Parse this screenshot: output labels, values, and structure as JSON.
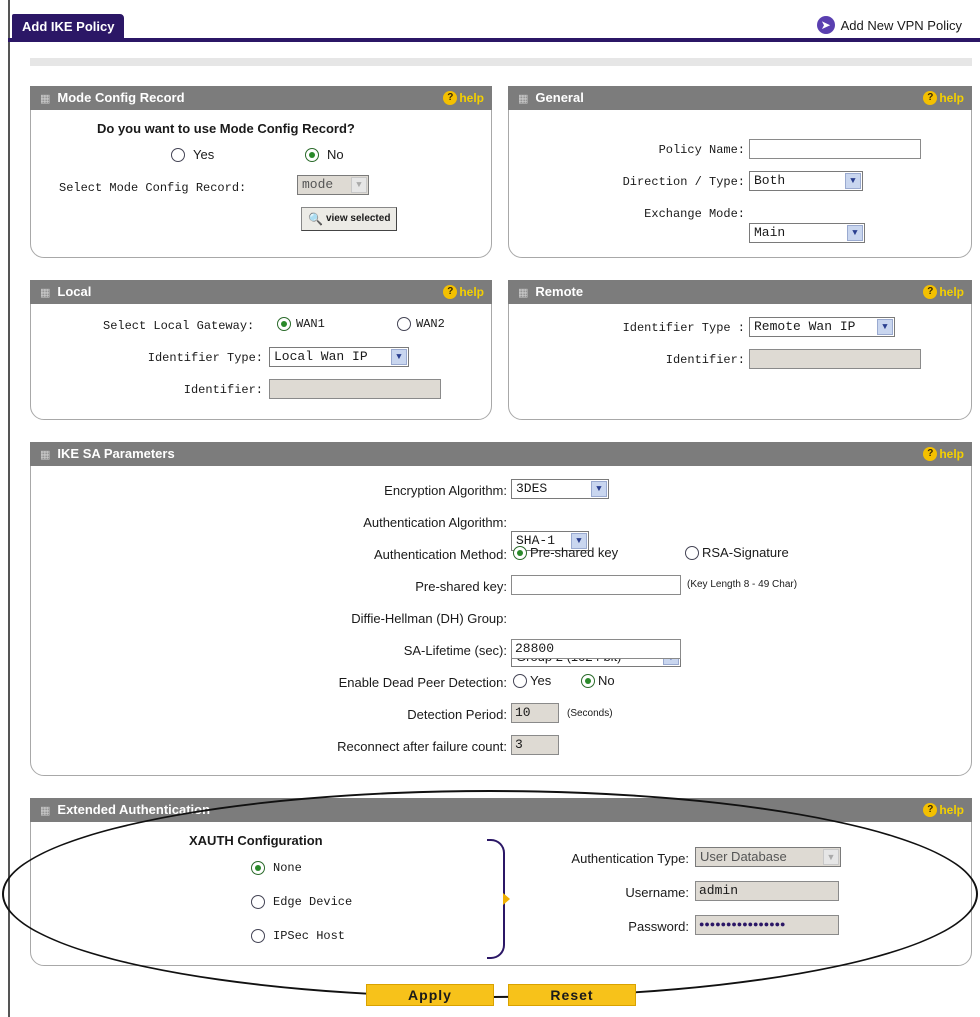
{
  "header": {
    "tab_label": "Add IKE Policy",
    "add_link": "Add New VPN Policy"
  },
  "help_label": "help",
  "mode_config": {
    "title": "Mode Config Record",
    "question": "Do you want to use Mode Config Record?",
    "yes": "Yes",
    "no": "No",
    "selected": "No",
    "select_label": "Select Mode Config Record:",
    "select_value": "mode",
    "view_button": "view selected"
  },
  "general": {
    "title": "General",
    "policy_name_label": "Policy Name:",
    "policy_name_value": "",
    "direction_label": "Direction / Type:",
    "direction_value": "Both",
    "exchange_label": "Exchange Mode:",
    "exchange_value": "Main"
  },
  "local": {
    "title": "Local",
    "gateway_label": "Select Local Gateway:",
    "wan1": "WAN1",
    "wan2": "WAN2",
    "selected": "WAN1",
    "identifier_type_label": "Identifier Type:",
    "identifier_type_value": "Local Wan IP",
    "identifier_label": "Identifier:",
    "identifier_value": ""
  },
  "remote": {
    "title": "Remote",
    "identifier_type_label": "Identifier Type :",
    "identifier_type_value": "Remote Wan IP",
    "identifier_label": "Identifier:",
    "identifier_value": ""
  },
  "ike_sa": {
    "title": "IKE SA Parameters",
    "encryption_label": "Encryption Algorithm:",
    "encryption_value": "3DES",
    "authentication_label": "Authentication Algorithm:",
    "authentication_value": "SHA-1",
    "auth_method_label": "Authentication Method:",
    "auth_method_psk": "Pre-shared key",
    "auth_method_rsa": "RSA-Signature",
    "auth_method_selected": "Pre-shared key",
    "psk_label": "Pre-shared key:",
    "psk_value": "",
    "psk_hint": "(Key Length 8 - 49 Char)",
    "dh_label": "Diffie-Hellman (DH) Group:",
    "dh_value": "Group 2 (1024 bit)",
    "lifetime_label": "SA-Lifetime (sec):",
    "lifetime_value": "28800",
    "dpd_label": "Enable Dead Peer Detection:",
    "dpd_yes": "Yes",
    "dpd_no": "No",
    "dpd_selected": "No",
    "detection_label": "Detection Period:",
    "detection_value": "10",
    "detection_unit": "(Seconds)",
    "reconnect_label": "Reconnect after failure count:",
    "reconnect_value": "3"
  },
  "xauth": {
    "title": "Extended Authentication",
    "config_title": "XAUTH Configuration",
    "options": [
      "None",
      "Edge Device",
      "IPSec Host"
    ],
    "selected": "None",
    "auth_type_label": "Authentication Type:",
    "auth_type_value": "User Database",
    "username_label": "Username:",
    "username_value": "admin",
    "password_label": "Password:",
    "password_value": "●●●●●●●●●●●●●●●●"
  },
  "actions": {
    "apply": "Apply",
    "reset": "Reset"
  },
  "colors": {
    "header_purple": "#2b1766",
    "panel_header_grey": "#7c7c7c",
    "button_yellow": "#f7c21a",
    "help_yellow": "#f4c000",
    "radio_green": "#2a8a2a"
  }
}
